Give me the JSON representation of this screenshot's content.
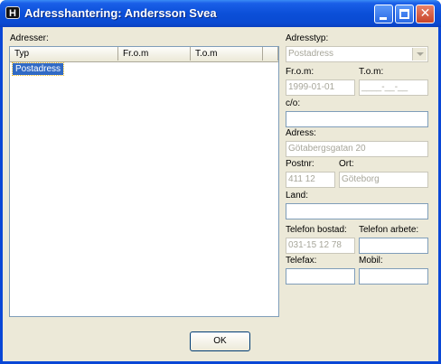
{
  "window": {
    "title": "Adresshantering: Andersson Svea",
    "app_icon_glyph": "H",
    "minimize_icon": "minimize-icon",
    "maximize_icon": "maximize-icon",
    "close_glyph": "✕"
  },
  "addresses": {
    "label": "Adresser:",
    "columns": [
      "Typ",
      "Fr.o.m",
      "T.o.m"
    ],
    "rows": [
      {
        "typ": "Postadress",
        "from": "",
        "to": ""
      }
    ]
  },
  "form": {
    "adresstyp": {
      "label": "Adresstyp:",
      "value": "Postadress"
    },
    "from": {
      "label": "Fr.o.m:",
      "value": "1999-01-01"
    },
    "tom": {
      "label": "T.o.m:",
      "value": "____-__-__"
    },
    "co": {
      "label": "c/o:",
      "value": ""
    },
    "adress": {
      "label": "Adress:",
      "value": "Götabergsgatan  20"
    },
    "postnr": {
      "label": "Postnr:",
      "value": "411 12"
    },
    "ort": {
      "label": "Ort:",
      "value": "Göteborg"
    },
    "land": {
      "label": "Land:",
      "value": ""
    },
    "tel_bostad": {
      "label": "Telefon bostad:",
      "value": "031-15 12 78"
    },
    "tel_arbete": {
      "label": "Telefon arbete:",
      "value": ""
    },
    "telefax": {
      "label": "Telefax:",
      "value": ""
    },
    "mobil": {
      "label": "Mobil:",
      "value": ""
    }
  },
  "buttons": {
    "ok": "OK"
  },
  "colors": {
    "titlebar": "#0a4ad2",
    "dialog_bg": "#ece9d8",
    "selection": "#316ac5",
    "disabled_text": "#a7a69a"
  }
}
